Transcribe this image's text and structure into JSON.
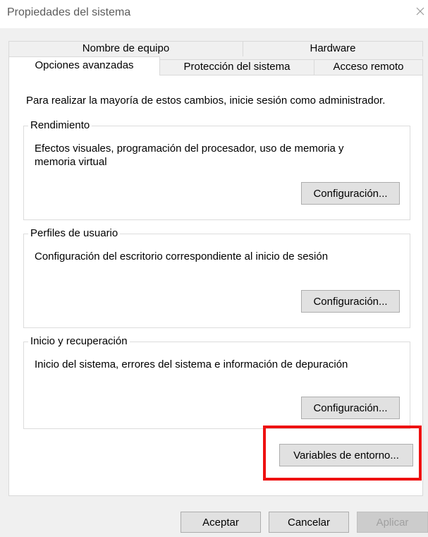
{
  "window": {
    "title": "Propiedades del sistema",
    "close_symbol": "×",
    "close_icon": "close-icon"
  },
  "tabs": {
    "row_top": [
      "Nombre de equipo",
      "Hardware"
    ],
    "row_bottom": [
      "Opciones avanzadas",
      "Protección del sistema",
      "Acceso remoto"
    ],
    "active": "Opciones avanzadas"
  },
  "panel": {
    "admin_note": "Para realizar la mayoría de estos cambios, inicie sesión como administrador.",
    "groups": [
      {
        "title": "Rendimiento",
        "description": "Efectos visuales, programación del procesador, uso de memoria y memoria virtual",
        "button": "Configuración..."
      },
      {
        "title": "Perfiles de usuario",
        "description": "Configuración del escritorio correspondiente al inicio de sesión",
        "button": "Configuración..."
      },
      {
        "title": "Inicio y recuperación",
        "description": "Inicio del sistema, errores del sistema e información de depuración",
        "button": "Configuración..."
      }
    ],
    "env_button": "Variables de entorno..."
  },
  "footer": {
    "ok": "Aceptar",
    "cancel": "Cancelar",
    "apply": "Aplicar"
  },
  "colors": {
    "highlight": "#ee1111",
    "dialog_background": "#f0f0f0",
    "panel_background": "#ffffff"
  }
}
